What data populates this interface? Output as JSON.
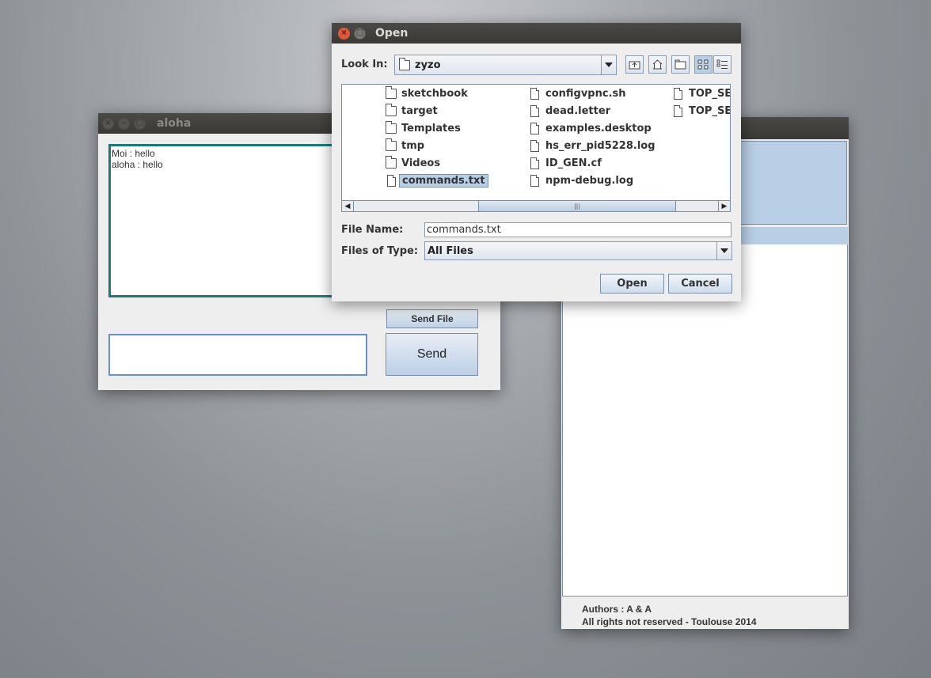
{
  "aloha_window": {
    "title": "aloha",
    "chat_lines": [
      "Moi : hello",
      "aloha : hello"
    ],
    "message_value": "",
    "send_file_label": "Send File",
    "send_label": "Send"
  },
  "right_window": {
    "footer_authors": "Authors : A & A",
    "footer_rights": "All rights not reserved - Toulouse 2014"
  },
  "open_dialog": {
    "title": "Open",
    "look_in_label": "Look In:",
    "look_in_value": "zyzo",
    "toolbar_icons": [
      "up-folder-icon",
      "home-icon",
      "new-folder-icon",
      "list-view-icon",
      "details-view-icon"
    ],
    "files_col1": [
      "sketchbook",
      "target",
      "Templates",
      "tmp",
      "Videos",
      "commands.txt"
    ],
    "files_col2": [
      "configvpnc.sh",
      "dead.letter",
      "examples.desktop",
      "hs_err_pid5228.log",
      "ID_GEN.cf",
      "npm-debug.log"
    ],
    "files_col3": [
      "TOP_SE(",
      "TOP_SE("
    ],
    "selected_file": "commands.txt",
    "file_name_label": "File Name:",
    "file_name_value": "commands.txt",
    "files_of_type_label": "Files of Type:",
    "files_of_type_value": "All Files",
    "open_label": "Open",
    "cancel_label": "Cancel"
  }
}
